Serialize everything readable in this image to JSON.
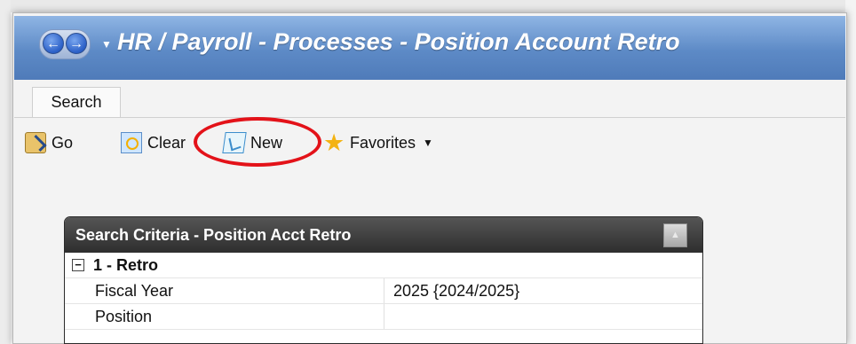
{
  "window": {
    "title": "HR / Payroll - Processes - Position Account Retro"
  },
  "tabs": [
    {
      "label": "Search"
    }
  ],
  "toolbar": {
    "go": "Go",
    "clear": "Clear",
    "new": "New",
    "favorites": "Favorites"
  },
  "panel": {
    "title": "Search Criteria - Position Acct Retro",
    "group": {
      "label": "1 - Retro",
      "expander": "−"
    },
    "rows": [
      {
        "label": "Fiscal Year",
        "value": "2025 {2024/2025}"
      },
      {
        "label": "Position",
        "value": ""
      }
    ]
  },
  "icons": {
    "back": "arrow-left-icon",
    "forward": "arrow-right-icon",
    "go": "go-icon",
    "clear": "clear-icon",
    "new": "new-icon",
    "favorites": "star-icon"
  },
  "colors": {
    "annotation": "#e31219",
    "title_bar": "#5d8ac6",
    "panel_header": "#2e2e2e"
  }
}
